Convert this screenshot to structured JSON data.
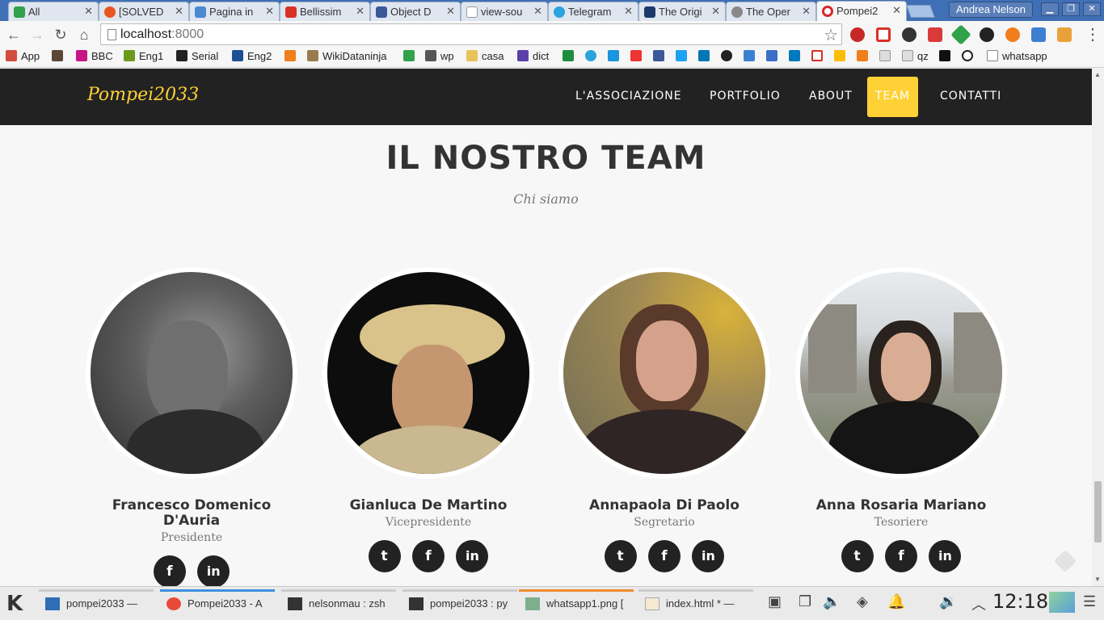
{
  "browser": {
    "tabs": [
      {
        "label": "All",
        "color": "#2fa24a"
      },
      {
        "label": "[SOLVED",
        "color": "#e95420"
      },
      {
        "label": "Pagina in",
        "color": "#4a8ad1"
      },
      {
        "label": "Bellissim",
        "color": "#d93025"
      },
      {
        "label": "Object D",
        "color": "#3b5998"
      },
      {
        "label": "view-sou",
        "color": "#cccccc"
      },
      {
        "label": "Telegram",
        "color": "#2aa3de"
      },
      {
        "label": "The Origi",
        "color": "#1b3a6b"
      },
      {
        "label": "The Oper",
        "color": "#888888"
      },
      {
        "label": "Pompei2",
        "color": "#d62828"
      }
    ],
    "user_label": "Andrea Nelson",
    "url_host": "localhost",
    "url_port": ":8000",
    "bookmarks": [
      {
        "label": "App",
        "color": "#d24c3f"
      },
      {
        "label": "",
        "color": "#5b4636"
      },
      {
        "label": "BBC",
        "color": "#c71585"
      },
      {
        "label": "Eng1",
        "color": "#6c9a1f"
      },
      {
        "label": "Serial",
        "color": "#222222"
      },
      {
        "label": "Eng2",
        "color": "#1b4f91"
      },
      {
        "label": "",
        "color": "#f07e1b"
      },
      {
        "label": "WikiDataninja",
        "color": "#9a7b4f"
      },
      {
        "label": "",
        "color": "#2fa24a"
      },
      {
        "label": "wp",
        "color": "#555555"
      },
      {
        "label": "casa",
        "color": "#e8c25a"
      },
      {
        "label": "dict",
        "color": "#5b3fa8"
      }
    ],
    "bookmarks_end": "whatsapp",
    "bookmarks_qz": "qz"
  },
  "site": {
    "brand": "Pompei2033",
    "nav": [
      "L'ASSOCIAZIONE",
      "PORTFOLIO",
      "ABOUT",
      "TEAM",
      "CONTATTI"
    ],
    "active_nav": "TEAM",
    "accent": "#fed136",
    "heading": "IL NOSTRO TEAM",
    "subheading": "Chi siamo",
    "members": [
      {
        "name_line1": "Francesco Domenico",
        "name_line2": "D'Auria",
        "role": "Presidente"
      },
      {
        "name_line1": "Gianluca De Martino",
        "name_line2": "",
        "role": "Vicepresidente"
      },
      {
        "name_line1": "Annapaola Di Paolo",
        "name_line2": "",
        "role": "Segretario"
      },
      {
        "name_line1": "Anna Rosaria Mariano",
        "name_line2": "",
        "role": "Tesoriere"
      }
    ],
    "social": {
      "twitter": "t",
      "facebook": "f",
      "linkedin": "in"
    }
  },
  "taskbar": {
    "tasks": [
      {
        "label": "pompei2033 — ",
        "accent": "#cccccc"
      },
      {
        "label": "Pompei2033 - A",
        "accent": "#3d8fe0"
      },
      {
        "label": "nelsonmau : zsh",
        "accent": "#cccccc"
      },
      {
        "label": "pompei2033 : py",
        "accent": "#cccccc"
      },
      {
        "label": "whatsapp1.png [",
        "accent": "#f08c30"
      },
      {
        "label": "index.html * — ",
        "accent": "#cccccc"
      }
    ],
    "clock": "12:18"
  }
}
